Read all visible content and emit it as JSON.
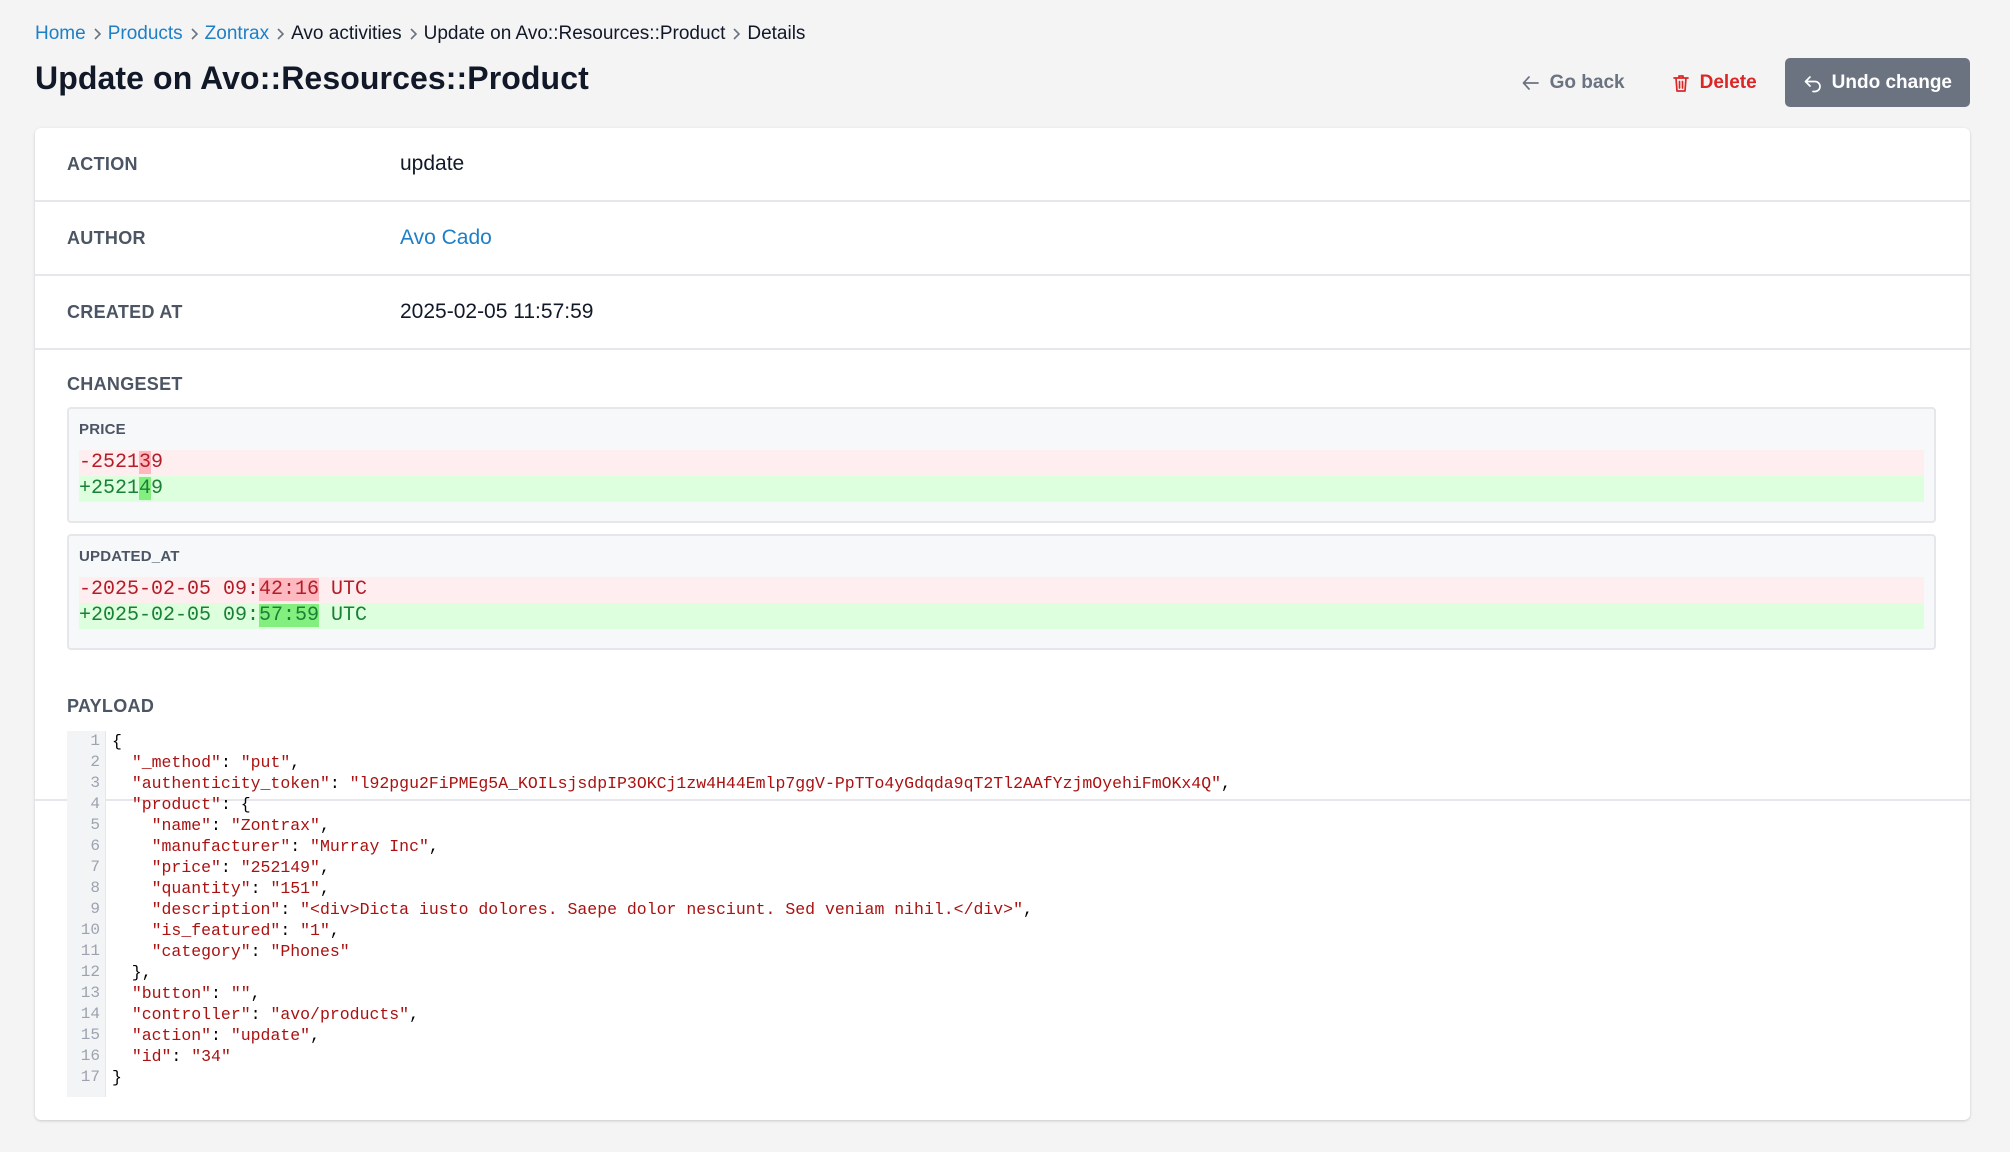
{
  "breadcrumb": {
    "items": [
      {
        "label": "Home",
        "link": true
      },
      {
        "label": "Products",
        "link": true
      },
      {
        "label": "Zontrax",
        "link": true
      },
      {
        "label": "Avo activities",
        "link": false
      },
      {
        "label": "Update on Avo::Resources::Product",
        "link": false
      },
      {
        "label": "Details",
        "link": false
      }
    ]
  },
  "header": {
    "title": "Update on Avo::Resources::Product",
    "go_back_label": "Go back",
    "delete_label": "Delete",
    "undo_label": "Undo change"
  },
  "details": {
    "action_label": "ACTION",
    "action_value": "update",
    "author_label": "AUTHOR",
    "author_value": "Avo Cado",
    "created_at_label": "CREATED AT",
    "created_at_value": "2025-02-05 11:57:59"
  },
  "changeset": {
    "label": "CHANGESET",
    "fields": [
      {
        "name": "PRICE",
        "removed": {
          "prefix": "-25213",
          "prefix_plain": "-2521",
          "changed": "3",
          "suffix": "9"
        },
        "added": {
          "prefix_plain": "+2521",
          "changed": "4",
          "suffix": "9"
        }
      },
      {
        "name": "UPDATED_AT",
        "removed": {
          "prefix_plain": "-2025-02-05 09:",
          "changed": "42:16",
          "suffix": " UTC"
        },
        "added": {
          "prefix_plain": "+2025-02-05 09:",
          "changed": "57:59",
          "suffix": " UTC"
        }
      }
    ]
  },
  "payload": {
    "label": "PAYLOAD",
    "lines": [
      "{",
      "  \"_method\": \"put\",",
      "  \"authenticity_token\": \"l92pgu2FiPMEg5A_KOILsjsdpIP3OKCj1zw4H44Emlp7ggV-PpTTo4yGdqda9qT2Tl2AAfYzjmOyehiFmOKx4Q\",",
      "  \"product\": {",
      "    \"name\": \"Zontrax\",",
      "    \"manufacturer\": \"Murray Inc\",",
      "    \"price\": \"252149\",",
      "    \"quantity\": \"151\",",
      "    \"description\": \"<div>Dicta iusto dolores. Saepe dolor nesciunt. Sed veniam nihil.</div>\",",
      "    \"is_featured\": \"1\",",
      "    \"category\": \"Phones\"",
      "  },",
      "  \"button\": \"\",",
      "  \"controller\": \"avo/products\",",
      "  \"action\": \"update\",",
      "  \"id\": \"34\"",
      "}"
    ]
  },
  "colors": {
    "link": "#1d7fc6",
    "delete": "#dc2626",
    "undo_bg": "#6b7280",
    "diff_removed_bg": "#ffeef0",
    "diff_added_bg": "#ddffdd",
    "string": "#aa1111"
  },
  "icons": {
    "go_back": "arrow-left-icon",
    "delete": "trash-icon",
    "undo": "undo-arrow-icon",
    "separator": "chevron-right-icon"
  }
}
